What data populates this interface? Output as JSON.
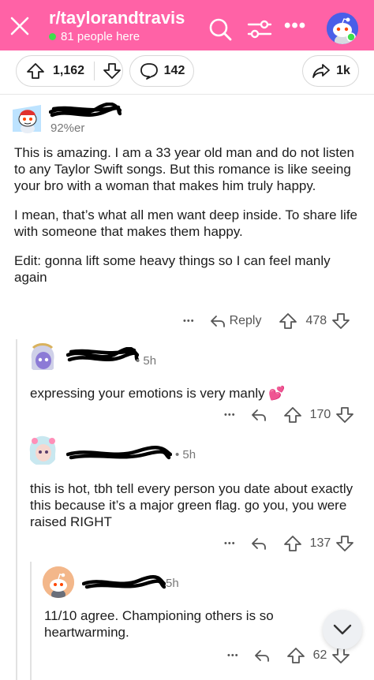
{
  "header": {
    "subreddit": "r/taylorandtravis",
    "online_text": "81 people here",
    "more_label": "•••",
    "bg_color": "#ff62a6"
  },
  "post_actions": {
    "upvotes": "1,162",
    "comments": "142",
    "share": "1k"
  },
  "comments": [
    {
      "author_flair": "92%er",
      "paragraphs": [
        "This is amazing. I am a 33 year old man and do not listen to any Taylor Swift songs. But this romance is like seeing your bro with a woman that makes him truly happy.",
        "I mean, that’s what all men want deep inside. To share life with someone that makes them happy.",
        "Edit: gonna lift some heavy things so I can feel manly again"
      ],
      "reply_label": "Reply",
      "votes": "478",
      "more_label": "•••"
    },
    {
      "time": "• 5h",
      "body": "expressing your emotions is very manly 💕",
      "votes": "170",
      "more_label": "•••"
    },
    {
      "time": "• 5h",
      "body": "this is hot, tbh tell every person you date about exactly this because it’s a major green flag. go you, you were raised RIGHT",
      "votes": "137",
      "more_label": "•••"
    },
    {
      "time": "5h",
      "body": "11/10 agree. Championing others is so heartwarming.",
      "votes": "62",
      "more_label": "•••"
    }
  ],
  "icons": {
    "close": "close-icon",
    "search": "search-icon",
    "filter": "filter-icon",
    "upvote": "arrow-up-icon",
    "downvote": "arrow-down-icon",
    "comment": "comment-bubble-icon",
    "share": "share-arrow-icon",
    "reply": "reply-arrow-icon",
    "scroll": "chevron-down-icon"
  }
}
